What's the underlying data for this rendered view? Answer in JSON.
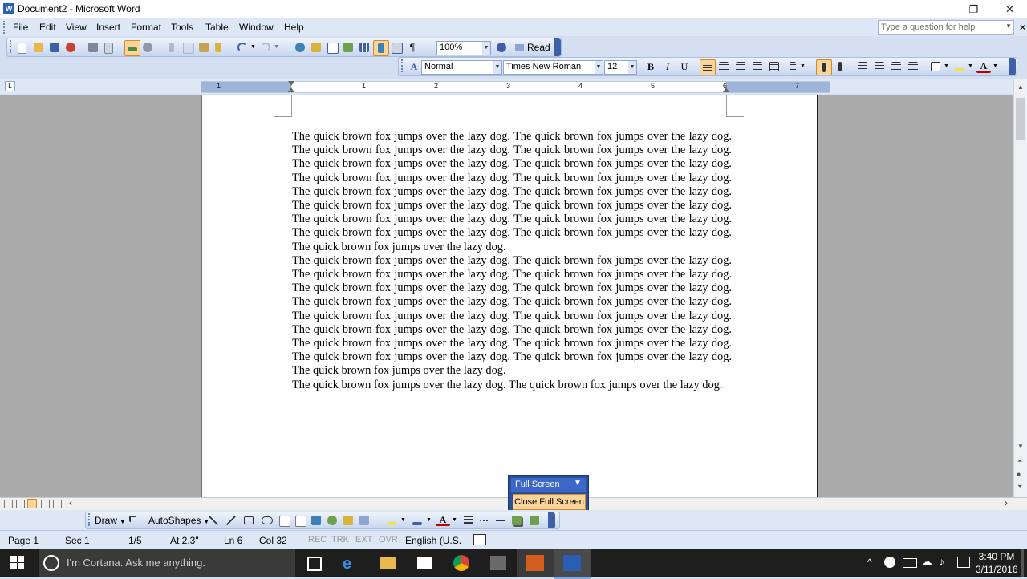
{
  "window": {
    "title": "Document2 - Microsoft Word",
    "app_icon": "W",
    "minimize": "—",
    "restore": "❐",
    "close": "✕"
  },
  "menubar": {
    "items": [
      "File",
      "Edit",
      "View",
      "Insert",
      "Format",
      "Tools",
      "Table",
      "Window",
      "Help"
    ],
    "help_placeholder": "Type a question for help"
  },
  "standard_toolbar": {
    "zoom": "100%",
    "read_label": "Read",
    "show_hide": "¶"
  },
  "formatting_toolbar": {
    "style": "Normal",
    "font": "Times New Roman",
    "size": "12",
    "bold": "B",
    "italic": "I",
    "underline": "U",
    "font_color_letter": "A",
    "style_icon_letter": "A"
  },
  "ruler": {
    "numbers": [
      "1",
      "1",
      "2",
      "3",
      "4",
      "5",
      "6",
      "7"
    ]
  },
  "document": {
    "paragraphs": [
      "The quick brown fox jumps over the lazy dog.  The quick brown fox jumps over the lazy dog.  The quick brown fox jumps over the lazy dog.  The quick brown fox jumps over the lazy dog.  The quick brown fox jumps over the lazy dog.  The quick brown fox jumps over the lazy dog.  The quick brown fox jumps over the lazy dog.  The quick brown fox jumps over the lazy dog.  The quick brown fox jumps over the lazy dog.  The quick brown fox jumps over the lazy dog.  The quick brown fox jumps over the lazy dog.  The quick brown fox jumps over the lazy dog.  The quick brown fox jumps over the lazy dog.  The quick brown fox jumps over the lazy dog.  The quick brown fox jumps over the lazy dog.  The quick brown fox jumps over the lazy dog.  The quick brown fox jumps over the lazy dog.",
      "The quick brown fox jumps over the lazy dog.  The quick brown fox jumps over the lazy dog.  The quick brown fox jumps over the lazy dog.  The quick brown fox jumps over the lazy dog.  The quick brown fox jumps over the lazy dog.  The quick brown fox jumps over the lazy dog.  The quick brown fox jumps over the lazy dog.  The quick brown fox jumps over the lazy dog.  The quick brown fox jumps over the lazy dog.  The quick brown fox jumps over the lazy dog.  The quick brown fox jumps over the lazy dog.  The quick brown fox jumps over the lazy dog.  The quick brown fox jumps over the lazy dog.  The quick brown fox jumps over the lazy dog.  The quick brown fox jumps over the lazy dog.  The quick brown fox jumps over the lazy dog.  The quick brown fox jumps over the lazy dog.",
      "The quick brown fox jumps over the lazy dog.  The quick brown fox jumps over the lazy dog."
    ]
  },
  "fullscreen_toolbar": {
    "title": "Full Screen",
    "close_label": "Close Full Screen"
  },
  "drawing_toolbar": {
    "draw_label": "Draw",
    "autoshapes_label": "AutoShapes"
  },
  "statusbar": {
    "page": "Page 1",
    "section": "Sec 1",
    "page_count": "1/5",
    "at": "At 2.3\"",
    "line": "Ln 6",
    "col": "Col 32",
    "rec": "REC",
    "trk": "TRK",
    "ext": "EXT",
    "ovr": "OVR",
    "language": "English (U.S."
  },
  "taskbar": {
    "cortana_placeholder": "I'm Cortana. Ask me anything.",
    "time": "3:40 PM",
    "date": "3/11/2016"
  },
  "colors": {
    "title_bg": "#ffffff",
    "chrome_bg": "#dde7f6",
    "doc_bg": "#ababab",
    "taskbar_bg": "#1e1e1e",
    "highlight": "#fbd49a"
  }
}
